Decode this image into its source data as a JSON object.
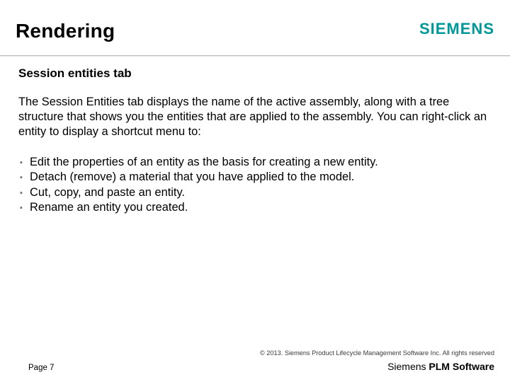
{
  "header": {
    "title": "Rendering",
    "brand": "SIEMENS"
  },
  "content": {
    "subhead": "Session entities tab",
    "paragraph": "The Session Entities tab displays the name of the active assembly, along with a tree structure that shows you the entities that are applied to the assembly. You can right-click an entity to display a shortcut menu to:",
    "bullets": [
      "Edit the properties of an entity as the basis for creating a new entity.",
      "Detach (remove) a material that you have applied to the model.",
      "Cut, copy, and paste an entity.",
      "Rename an entity you created."
    ]
  },
  "footer": {
    "copyright": "© 2013. Siemens Product Lifecycle Management Software Inc. All rights reserved",
    "page": "Page 7",
    "product_prefix": "Siemens ",
    "product_bold": "PLM Software"
  }
}
